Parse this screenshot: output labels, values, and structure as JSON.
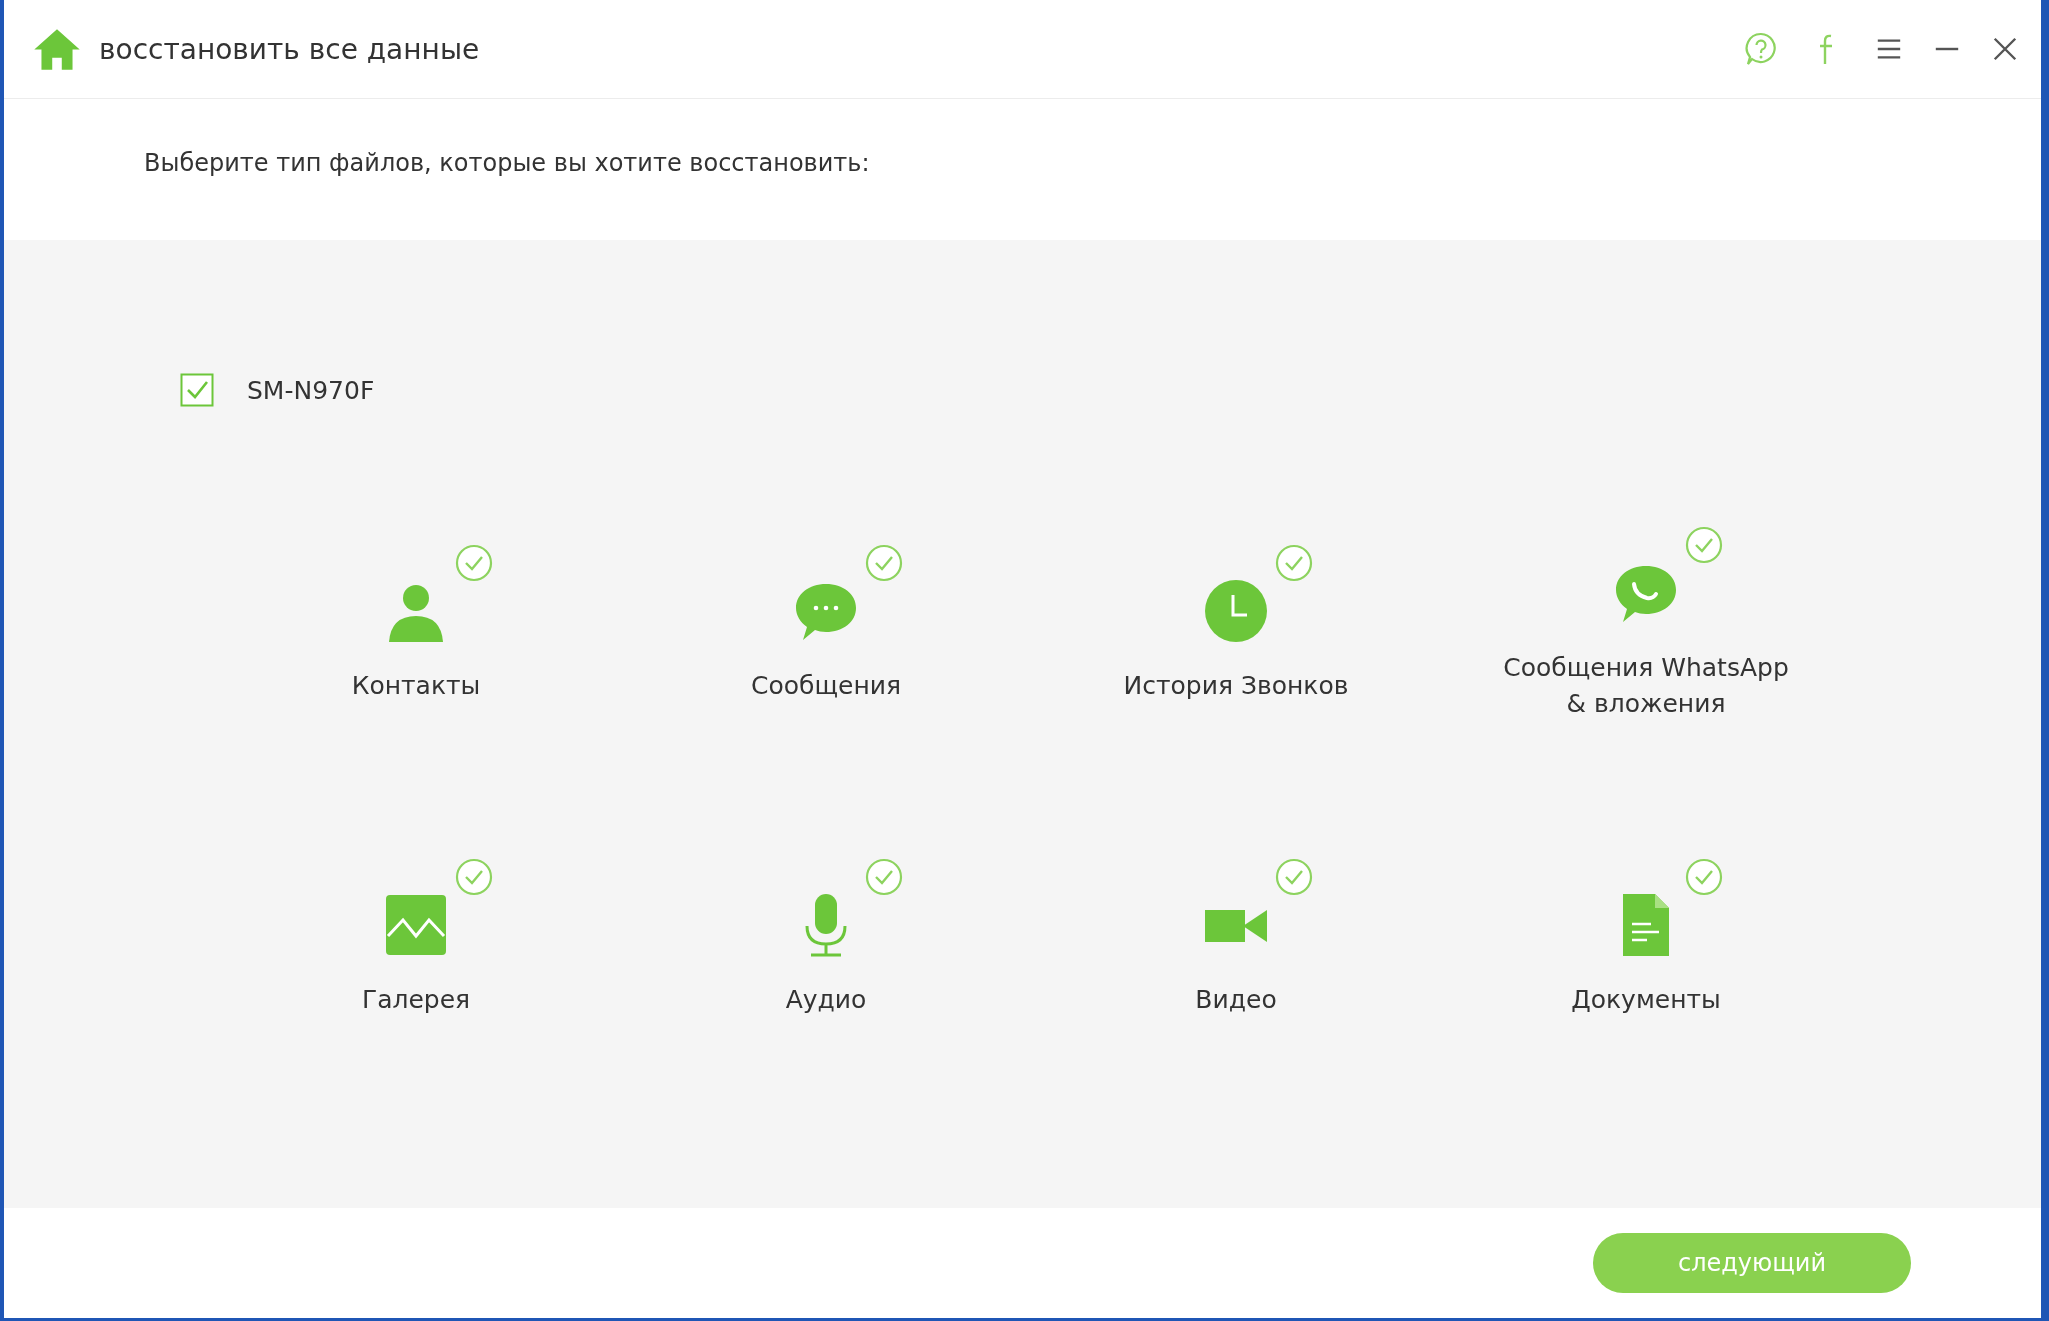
{
  "header": {
    "title": "восстановить все данные"
  },
  "prompt": "Выберите тип файлов, которые вы хотите восстановить:",
  "device": {
    "name": "SM-N970F",
    "checked": true
  },
  "categories": [
    {
      "kind": "contacts",
      "label": "Контакты",
      "checked": true
    },
    {
      "kind": "messages",
      "label": "Сообщения",
      "checked": true
    },
    {
      "kind": "calls",
      "label": "История Звонков",
      "checked": true
    },
    {
      "kind": "whatsapp",
      "label": "Сообщения WhatsApp\n& вложения",
      "checked": true
    },
    {
      "kind": "gallery",
      "label": "Галерея",
      "checked": true
    },
    {
      "kind": "audio",
      "label": "Аудио",
      "checked": true
    },
    {
      "kind": "video",
      "label": "Видео",
      "checked": true
    },
    {
      "kind": "documents",
      "label": "Документы",
      "checked": true
    }
  ],
  "next_button": "следующий"
}
